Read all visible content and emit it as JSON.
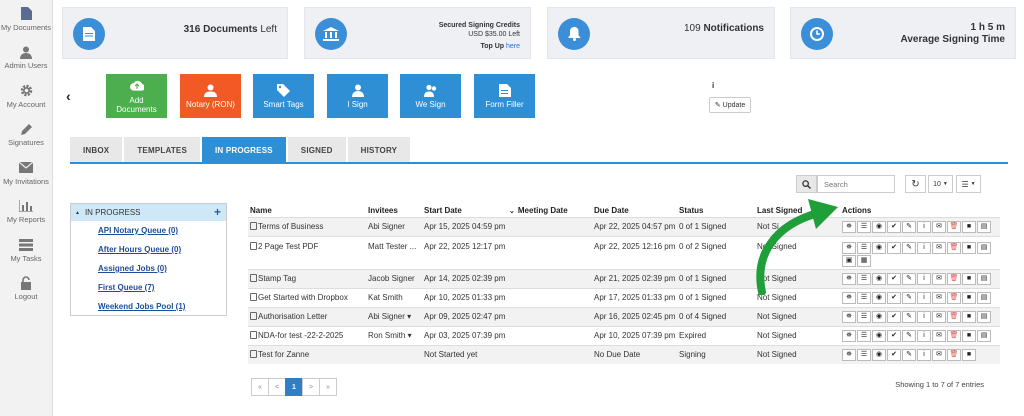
{
  "sidebar": {
    "items": [
      {
        "label": "My Documents",
        "icon": "document-icon"
      },
      {
        "label": "Admin Users",
        "icon": "user-icon"
      },
      {
        "label": "My Account",
        "icon": "gear-icon"
      },
      {
        "label": "Signatures",
        "icon": "pen-icon"
      },
      {
        "label": "My Invitations",
        "icon": "envelope-icon"
      },
      {
        "label": "My Reports",
        "icon": "bar-chart-icon"
      },
      {
        "label": "My Tasks",
        "icon": "list-icon"
      },
      {
        "label": "Logout",
        "icon": "lock-icon"
      }
    ]
  },
  "stats": {
    "documents": {
      "count": "316",
      "label": "Documents",
      "suffix": "Left"
    },
    "credits": {
      "title": "Secured Signing Credits",
      "amount": "USD $35.00 Left",
      "topup": "Top Up",
      "here": "here"
    },
    "notifications": {
      "count": "109",
      "label": "Notifications"
    },
    "time": {
      "value": "1 h 5 m",
      "label": "Average Signing Time"
    }
  },
  "tiles": {
    "add_documents": "Add Documents",
    "notary": "Notary (RON)",
    "smart_tags": "Smart Tags",
    "i_sign": "I Sign",
    "we_sign": "We Sign",
    "form_filler": "Form Filler"
  },
  "update": {
    "info": "i",
    "label": "Update"
  },
  "tabs": [
    "INBOX",
    "TEMPLATES",
    "IN PROGRESS",
    "SIGNED",
    "HISTORY"
  ],
  "toolbar": {
    "search_placeholder": "Search",
    "page_size": "10"
  },
  "queue": {
    "header": "IN PROGRESS",
    "items": [
      "API Notary Queue (0)",
      "After Hours Queue (0)",
      "Assigned Jobs (0)",
      "First Queue (7)",
      "Weekend Jobs Pool (1)"
    ]
  },
  "table": {
    "columns": [
      "Name",
      "Invitees",
      "Start Date",
      "Meeting Date",
      "Due Date",
      "Status",
      "Last Signed",
      "Actions"
    ],
    "rows": [
      {
        "name": "Terms of Business",
        "invitees": "Abi Signer",
        "start": "Apr 15, 2025 04:59 pm",
        "meeting": "",
        "due": "Apr 22, 2025 04:57 pm",
        "status": "0 of 1 Signed",
        "last": "Not Si"
      },
      {
        "name": "2 Page Test PDF",
        "invitees": "Matt Tester ...",
        "start": "Apr 22, 2025 12:17 pm",
        "meeting": "",
        "due": "Apr 22, 2025 12:16 pm",
        "status": "0 of 2 Signed",
        "last": "Not Signed"
      },
      {
        "name": "Stamp Tag",
        "invitees": "Jacob Signer",
        "start": "Apr 14, 2025 02:39 pm",
        "meeting": "",
        "due": "Apr 21, 2025 02:39 pm",
        "status": "0 of 1 Signed",
        "last": "Not Signed"
      },
      {
        "name": "Get Started with Dropbox",
        "invitees": "Kat Smith",
        "start": "Apr 10, 2025 01:33 pm",
        "meeting": "",
        "due": "Apr 17, 2025 01:33 pm",
        "status": "0 of 1 Signed",
        "last": "Not Signed"
      },
      {
        "name": "Authorisation Letter",
        "invitees": "Abi Signer ▾",
        "start": "Apr 09, 2025 02:47 pm",
        "meeting": "",
        "due": "Apr 16, 2025 02:45 pm",
        "status": "0 of 4 Signed",
        "last": "Not Signed"
      },
      {
        "name": "NDA-for test -22-2-2025",
        "invitees": "Ron Smith ▾",
        "start": "Apr 03, 2025 07:39 pm",
        "meeting": "",
        "due": "Apr 10, 2025 07:39 pm",
        "status": "Expired",
        "last": "Not Signed"
      },
      {
        "name": "Test for Zanne",
        "invitees": "",
        "start": "Not Started yet",
        "meeting": "",
        "due": "No Due Date",
        "status": "Signing",
        "last": "Not Signed"
      }
    ]
  },
  "pagination": {
    "first": "«",
    "prev": "<",
    "page": "1",
    "next": ">",
    "last": "»",
    "showing": "Showing 1 to 7 of 7 entries"
  },
  "colors": {
    "accent": "#2f8fd4",
    "green": "#4cae4c",
    "orange": "#f15a24",
    "blue_tile": "#2f8fd4",
    "arrow": "#1f9e3a"
  }
}
